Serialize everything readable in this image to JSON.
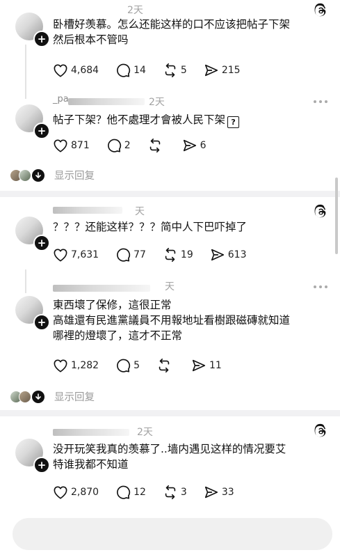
{
  "posts": [
    {
      "time": "2天",
      "lines": [
        "卧槽好羡慕。怎么还能这样的口不应该把帖子下架",
        "然后根本不管吗"
      ],
      "likes": "4,684",
      "comments": "14",
      "reposts": "5",
      "shares": "215"
    },
    {
      "username": "_pa",
      "time": "2天",
      "line": "帖子下架？他不處理才會被人民下架",
      "likes": "871",
      "comments": "2",
      "reposts": "",
      "shares": "6"
    },
    {
      "time": "天",
      "line": "？？？还能这样？？？简中人下巴吓掉了",
      "likes": "7,631",
      "comments": "77",
      "reposts": "19",
      "shares": "613"
    },
    {
      "time": "天",
      "lines": [
        "東西壞了保修，這很正常",
        "高雄還有民進黨議員不用報地址看樹跟磁磚就知道",
        "哪裡的燈壞了，這才不正常"
      ],
      "likes": "1,282",
      "comments": "5",
      "reposts": "",
      "shares": "11"
    },
    {
      "time": "2天",
      "lines": [
        "没开玩笑我真的羡慕了..墙内遇见这样的情况要艾",
        "特谁我都不知道"
      ],
      "likes": "2,870",
      "comments": "12",
      "reposts": "3",
      "shares": "33"
    }
  ],
  "show_replies_label": "显示回复",
  "question_glyph": "?",
  "plus_glyph": "+"
}
